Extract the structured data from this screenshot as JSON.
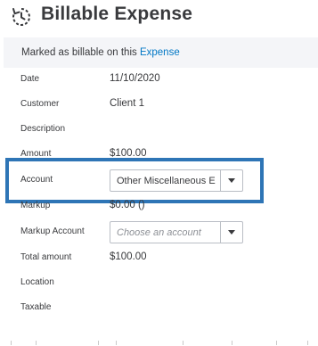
{
  "header": {
    "title": "Billable Expense",
    "icon": "billable-expense-icon"
  },
  "info": {
    "prefix": "Marked as billable on this",
    "link": "Expense"
  },
  "fields": {
    "date": {
      "label": "Date",
      "value": "11/10/2020"
    },
    "customer": {
      "label": "Customer",
      "value": "Client 1"
    },
    "description": {
      "label": "Description",
      "value": ""
    },
    "amount": {
      "label": "Amount",
      "value": "$100.00"
    },
    "account": {
      "label": "Account",
      "value": "Other Miscellaneous E"
    },
    "markup": {
      "label": "Markup",
      "value": "$0.00 ()"
    },
    "markup_account": {
      "label": "Markup Account",
      "placeholder": "Choose an account"
    },
    "total_amount": {
      "label": "Total amount",
      "value": "$100.00"
    },
    "location": {
      "label": "Location",
      "value": ""
    },
    "taxable": {
      "label": "Taxable",
      "value": ""
    }
  },
  "colors": {
    "link": "#0077c5",
    "highlight_border": "#2e75b6",
    "info_background": "#f4f5f8",
    "text": "#393a3d"
  }
}
